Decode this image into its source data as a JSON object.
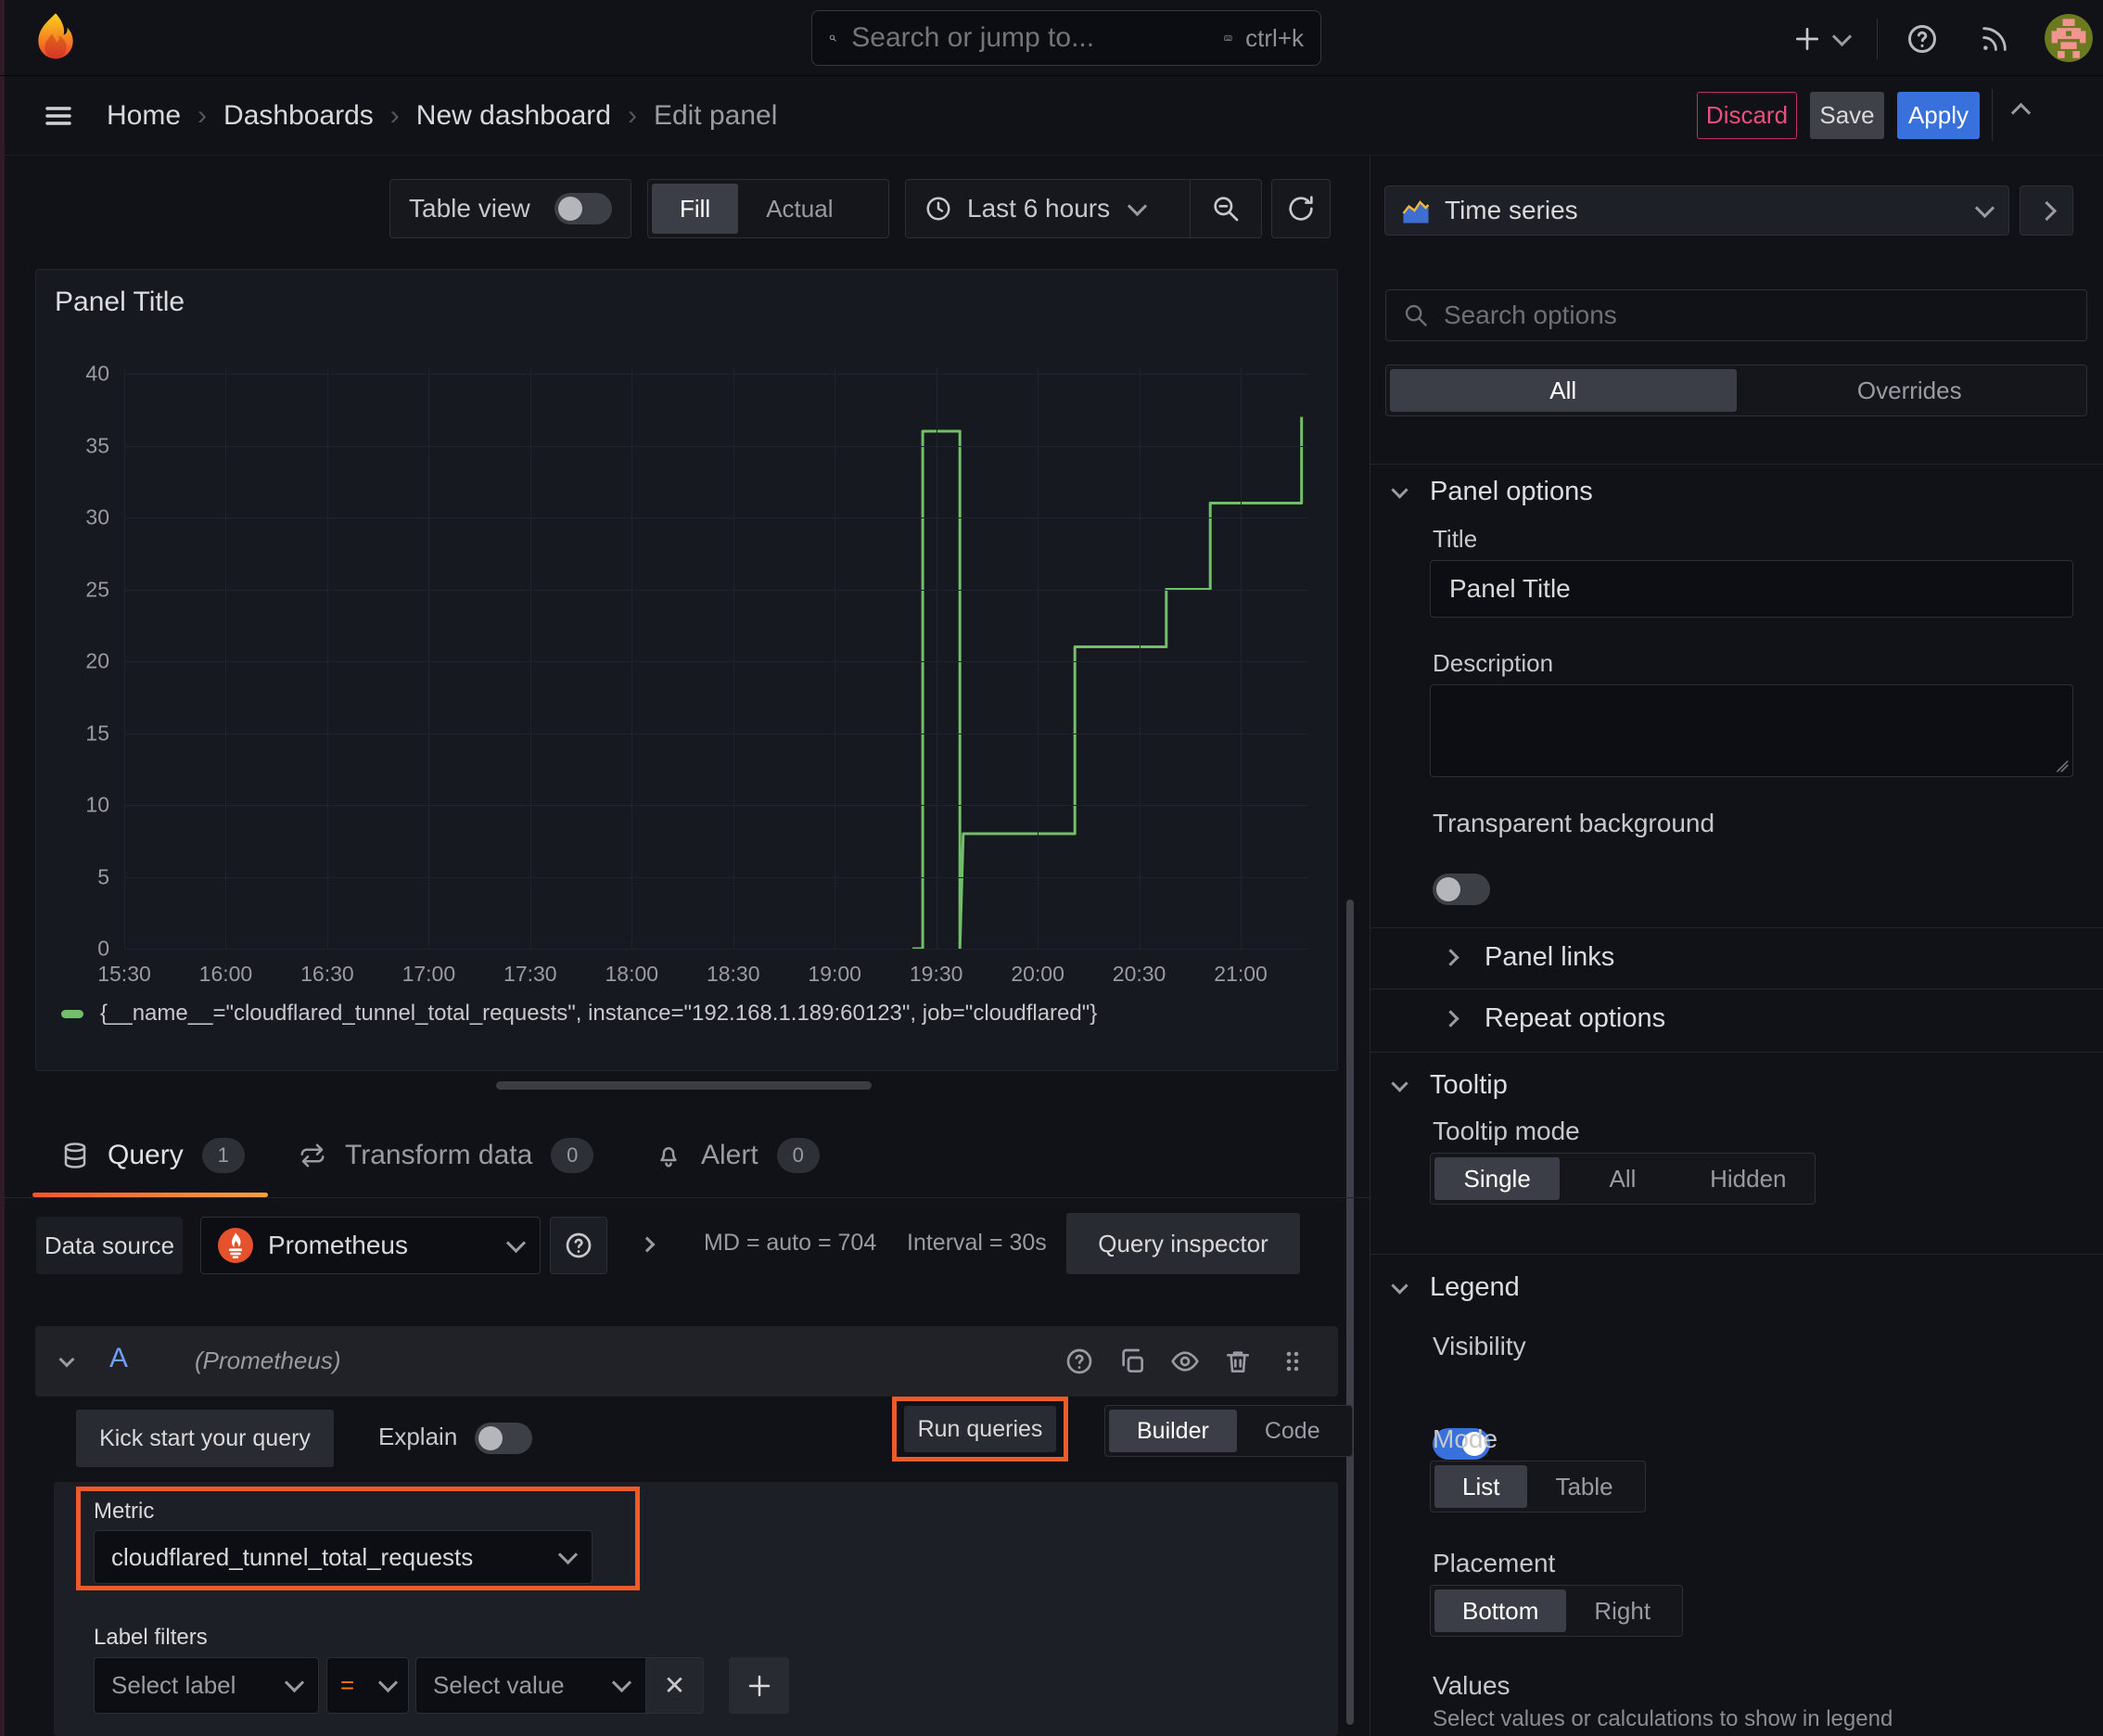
{
  "colors": {
    "accent_orange": "#ee5a29",
    "accent_blue": "#3871dc",
    "series_green": "#73bf69",
    "danger_pink": "#ea4f7d",
    "tab_underline_from": "#f2562b",
    "tab_underline_to": "#f9a03f"
  },
  "topbar": {
    "search_placeholder": "Search or jump to...",
    "search_shortcut": "ctrl+k"
  },
  "breadcrumb": {
    "home": "Home",
    "dashboards": "Dashboards",
    "new_dashboard": "New dashboard",
    "edit_panel": "Edit panel",
    "discard": "Discard",
    "save": "Save",
    "apply": "Apply"
  },
  "toolbar": {
    "table_view": "Table view",
    "fill": "Fill",
    "actual": "Actual",
    "time_range": "Last 6 hours"
  },
  "panel": {
    "title": "Panel Title"
  },
  "chart_data": {
    "type": "line",
    "line_style": "step-after",
    "title": "Panel Title",
    "xlabel": "",
    "ylabel": "",
    "ylim": [
      0,
      40
    ],
    "y_ticks": [
      0,
      5,
      10,
      15,
      20,
      25,
      30,
      35,
      40
    ],
    "x_ticks": [
      "15:30",
      "16:00",
      "16:30",
      "17:00",
      "17:30",
      "18:00",
      "18:30",
      "19:00",
      "19:30",
      "20:00",
      "20:30",
      "21:00"
    ],
    "x_domain": [
      "15:30",
      "21:20"
    ],
    "grid": true,
    "legend_position": "bottom",
    "series": [
      {
        "name": "{__name__=\"cloudflared_tunnel_total_requests\", instance=\"192.168.1.189:60123\", job=\"cloudflared\"}",
        "color": "#73bf69",
        "points": [
          [
            "19:23",
            0
          ],
          [
            "19:26",
            0
          ],
          [
            "19:26",
            36
          ],
          [
            "19:37",
            36
          ],
          [
            "19:37",
            0
          ],
          [
            "19:38",
            8
          ],
          [
            "20:11",
            8
          ],
          [
            "20:11",
            21
          ],
          [
            "20:38",
            21
          ],
          [
            "20:38",
            25
          ],
          [
            "20:51",
            25
          ],
          [
            "20:51",
            31
          ],
          [
            "21:18",
            31
          ],
          [
            "21:18",
            37
          ]
        ]
      }
    ]
  },
  "tabs": {
    "query": "Query",
    "query_count": "1",
    "transform": "Transform data",
    "transform_count": "0",
    "alert": "Alert",
    "alert_count": "0"
  },
  "query": {
    "datasource_label": "Data source",
    "datasource": "Prometheus",
    "md_stat": "MD = auto = 704",
    "interval_stat": "Interval = 30s",
    "inspector": "Query inspector",
    "ref": "A",
    "ref_datasource": "(Prometheus)",
    "kick_start": "Kick start your query",
    "explain": "Explain",
    "run_queries": "Run queries",
    "builder": "Builder",
    "code": "Code",
    "metric_label": "Metric",
    "metric_value": "cloudflared_tunnel_total_requests",
    "label_filters": "Label filters",
    "select_label": "Select label",
    "operator": "=",
    "select_value": "Select value"
  },
  "sidebar": {
    "visualization": "Time series",
    "search_placeholder": "Search options",
    "tab_all": "All",
    "tab_overrides": "Overrides",
    "panel_options": {
      "header": "Panel options",
      "title_label": "Title",
      "title_value": "Panel Title",
      "description_label": "Description",
      "transparent_bg": "Transparent background"
    },
    "panel_links": "Panel links",
    "repeat_options": "Repeat options",
    "tooltip": {
      "header": "Tooltip",
      "mode_label": "Tooltip mode",
      "single": "Single",
      "all": "All",
      "hidden": "Hidden"
    },
    "legend": {
      "header": "Legend",
      "visibility": "Visibility",
      "mode_label": "Mode",
      "list": "List",
      "table": "Table",
      "placement_label": "Placement",
      "bottom": "Bottom",
      "right": "Right",
      "values_label": "Values",
      "values_help": "Select values or calculations to show in legend"
    }
  }
}
